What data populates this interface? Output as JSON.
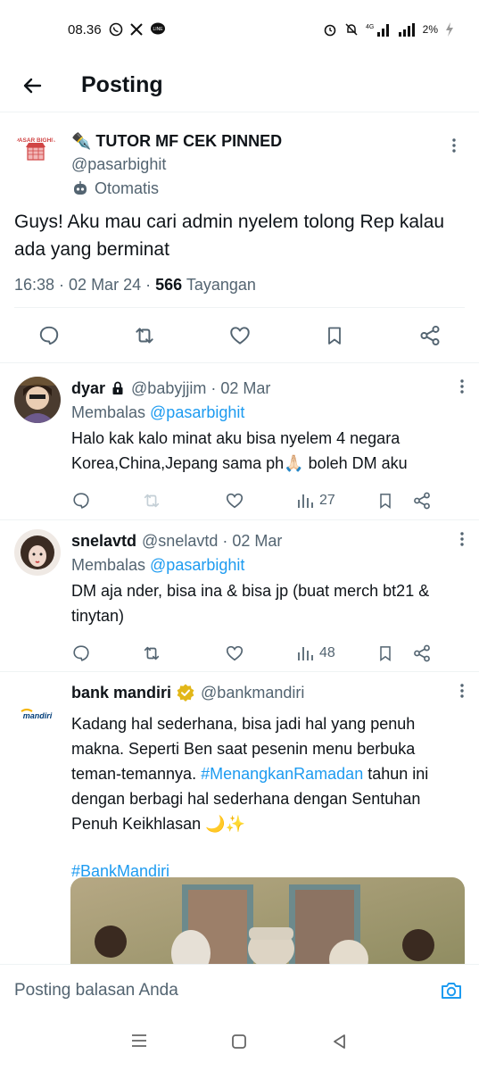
{
  "status": {
    "time": "08.36",
    "network": "4G",
    "battery": "2%"
  },
  "header": {
    "title": "Posting"
  },
  "main_post": {
    "display_name": "✒️ TUTOR MF CEK PINNED",
    "handle": "@pasarbighit",
    "avatar_text": "PASAR BIGHIT",
    "automated_label": "Otomatis",
    "text": "Guys! Aku mau cari admin nyelem tolong Rep kalau ada yang berminat",
    "timestamp": "16:38 · 02 Mar 24 · ",
    "views_count": "566",
    "views_label": "Tayangan"
  },
  "replies": [
    {
      "name": "dyar",
      "handle": "@babyjjim · 02 Mar",
      "replying_prefix": "Membalas ",
      "replying_to": "@pasarbighit",
      "text": "Halo kak kalo minat aku bisa nyelem 4 negara Korea,China,Jepang sama ph🙏🏻 boleh DM aku",
      "views": "27"
    },
    {
      "name": "snelavtd",
      "handle": "@snelavtd · 02 Mar",
      "replying_prefix": "Membalas ",
      "replying_to": "@pasarbighit",
      "text": "DM aja nder, bisa ina & bisa jp (buat merch bt21 & tinytan)",
      "views": "48"
    },
    {
      "name": "bank mandiri",
      "handle": "@bankmandiri",
      "avatar_text": "mandiri",
      "text_before": "Kadang hal sederhana, bisa jadi hal yang penuh makna. Seperti Ben saat pesenin menu berbuka teman-temannya. ",
      "hashtag1": "#MenangkanRamadan",
      "text_after": " tahun ini dengan berbagi hal sederhana dengan Sentuhan Penuh Keikhlasan 🌙✨",
      "hashtag2": "#BankMandiri"
    }
  ],
  "reply_bar": {
    "placeholder": "Posting balasan Anda"
  },
  "colors": {
    "accent": "#1d9bf0",
    "secondary_text": "#536471",
    "divider": "#eff3f4"
  }
}
